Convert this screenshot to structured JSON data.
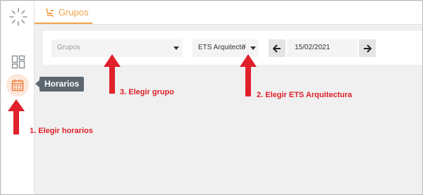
{
  "header": {
    "tab_label": "Grupos",
    "accent_color": "#f0a34a"
  },
  "sidebar": {
    "items": [
      {
        "name": "loading-spinner-icon"
      },
      {
        "name": "dashboard-icon"
      },
      {
        "name": "calendar-icon",
        "active": true,
        "tooltip": "Horarios"
      }
    ]
  },
  "filters": {
    "grupos_placeholder": "Grupos",
    "centro_value": "ETS Arquitectu",
    "clear_symbol": "×",
    "date_value": "15/02/2021"
  },
  "annotations": [
    {
      "step": 1,
      "text": "1. Elegir horarios"
    },
    {
      "step": 2,
      "text": "2. Elegir  ETS Arquitectura"
    },
    {
      "step": 3,
      "text": "3. Elegir grupo"
    }
  ],
  "annotation_color": "#e0202a"
}
